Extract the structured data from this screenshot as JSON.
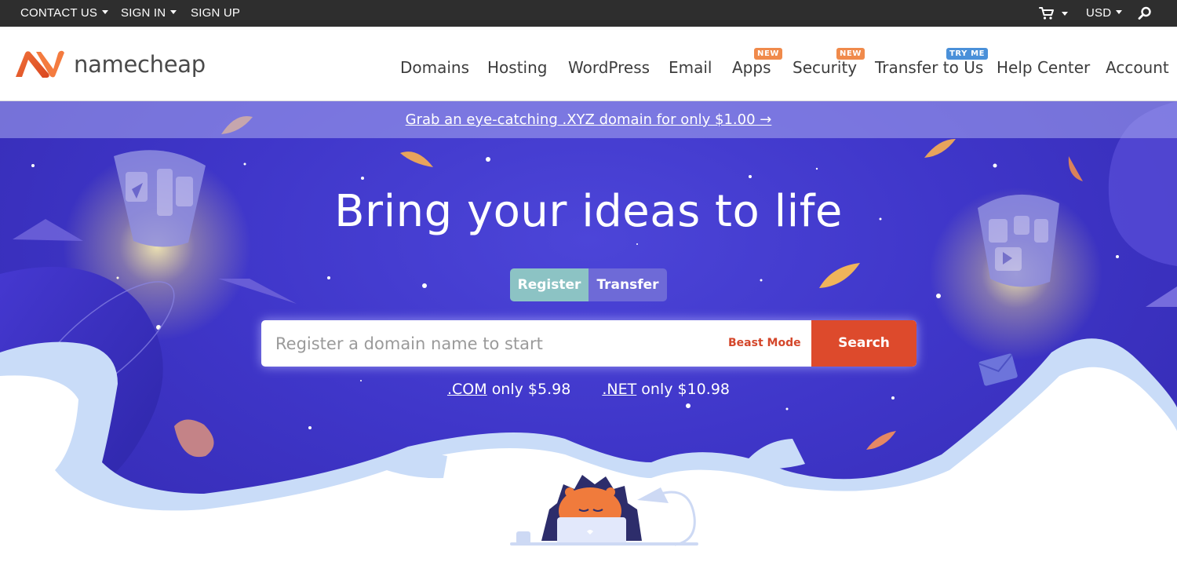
{
  "topbar": {
    "contact": "CONTACT US",
    "signin": "SIGN IN",
    "signup": "SIGN UP",
    "currency": "USD",
    "icons": [
      "cart-icon",
      "search-icon"
    ]
  },
  "header": {
    "logo_text": "namecheap",
    "nav": [
      {
        "label": "Domains"
      },
      {
        "label": "Hosting"
      },
      {
        "label": "WordPress"
      },
      {
        "label": "Email"
      },
      {
        "label": "Apps",
        "badge": "NEW"
      },
      {
        "label": "Security",
        "badge": "NEW"
      },
      {
        "label": "Transfer to Us",
        "badge": "TRY ME"
      },
      {
        "label": "Help Center"
      },
      {
        "label": "Account"
      }
    ]
  },
  "promo": {
    "text": "Grab an eye-catching .XYZ domain for only $1.00 →"
  },
  "hero": {
    "title": "Bring your ideas to life",
    "toggle": {
      "register": "Register",
      "transfer": "Transfer",
      "active": "Register"
    },
    "search": {
      "placeholder": "Register a domain name to start",
      "value": "",
      "beast_mode": "Beast Mode",
      "button": "Search"
    },
    "prices": [
      {
        "tld": ".COM",
        "text": "only $5.98"
      },
      {
        "tld": ".NET",
        "text": "only $10.98"
      }
    ]
  },
  "colors": {
    "topbar": "#2e2e2e",
    "brand_orange": "#e8572a",
    "hero_blue": "#3f36c9",
    "search_button": "#dd4a2c",
    "badge_new": "#f08a4b",
    "badge_tryme": "#4a90d9",
    "toggle_active": "#8cc3c4"
  }
}
